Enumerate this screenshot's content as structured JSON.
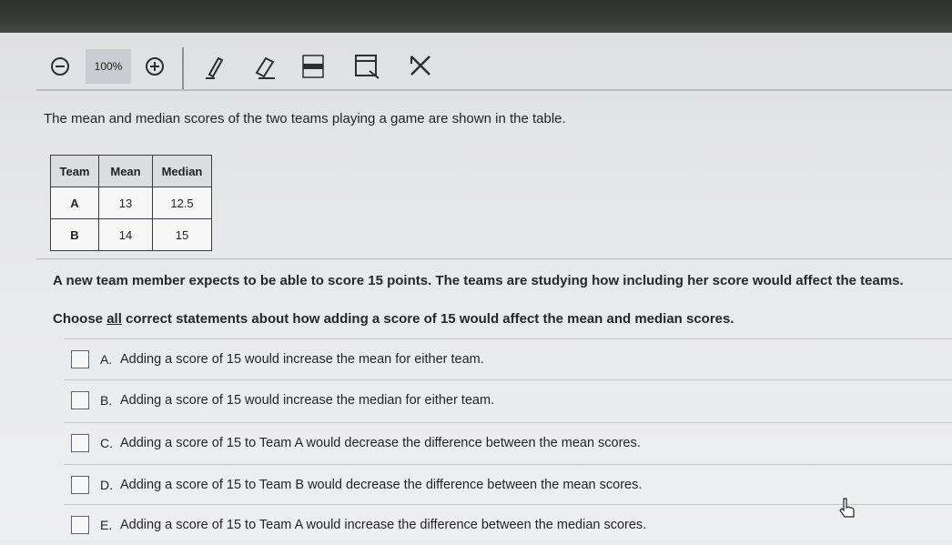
{
  "toolbar": {
    "zoom_out_icon": "zoom-out-icon",
    "zoom_level": "100%",
    "zoom_in_icon": "zoom-in-icon",
    "tools": [
      "pencil-icon",
      "eraser-icon",
      "highlighter-icon",
      "line-reader-icon",
      "cross-out-icon"
    ]
  },
  "question": {
    "intro": "The mean and median scores of the two teams playing a game are shown in the table.",
    "table": {
      "headers": [
        "Team",
        "Mean",
        "Median"
      ],
      "rows": [
        [
          "A",
          "13",
          "12.5"
        ],
        [
          "B",
          "14",
          "15"
        ]
      ]
    },
    "scenario": "A new team member expects to be able to score 15 points. The teams are studying how including her score would affect the teams.",
    "prompt_before": "Choose ",
    "prompt_underlined": "all",
    "prompt_after": " correct statements about how adding a score of 15 would affect the mean and median scores.",
    "choices": [
      {
        "letter": "A.",
        "text": "Adding a score of 15 would increase the mean for either team."
      },
      {
        "letter": "B.",
        "text": "Adding a score of 15 would increase the median for either team."
      },
      {
        "letter": "C.",
        "text": "Adding a score of 15 to Team A would decrease the difference between the mean scores."
      },
      {
        "letter": "D.",
        "text": "Adding a score of 15 to Team B would decrease the difference between the mean scores."
      },
      {
        "letter": "E.",
        "text": "Adding a score of 15 to Team A would increase the difference between the median scores."
      }
    ]
  }
}
